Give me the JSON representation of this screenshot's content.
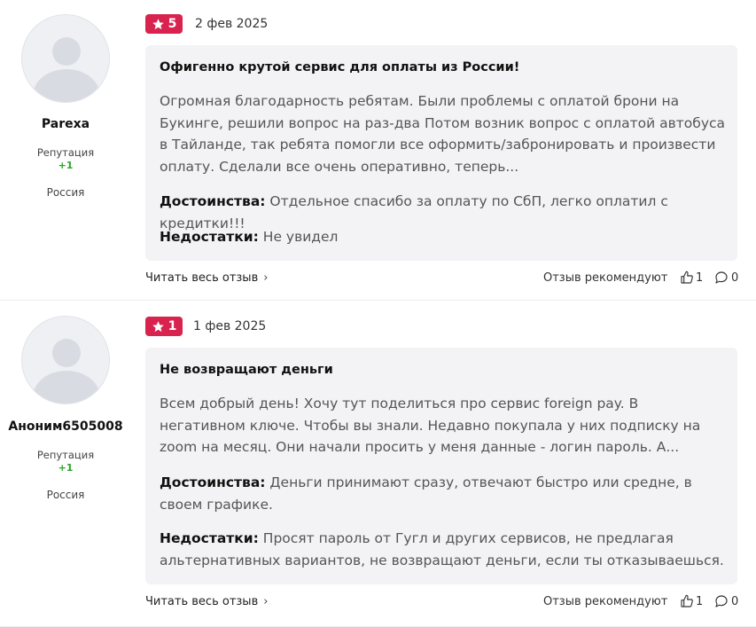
{
  "reviews": [
    {
      "username": "Parexa",
      "reputation_label": "Репутация",
      "reputation_value": "+1",
      "country": "Россия",
      "rating": "5",
      "date": "2 фев 2025",
      "title": "Офигенно крутой сервис для оплаты из России!",
      "text": "Огромная благодарность ребятам. Были проблемы с оплатой брони на Букинге, решили вопрос на раз-два Потом возник вопрос с оплатой автобуса в Тайланде, так ребята помогли все оформить/забронировать и произвести оплату. Сделали все очень оперативно, теперь...",
      "pros_label": "Достоинства:",
      "pros": "Отдельное спасибо за оплату по СбП, легко оплатил с кредитки!!!",
      "cons_label": "Недостатки:",
      "cons": "Не увидел",
      "read_more": "Читать весь отзыв",
      "recommend_label": "Отзыв рекомендуют",
      "likes": "1",
      "comments": "0"
    },
    {
      "username": "Аноним6505008",
      "reputation_label": "Репутация",
      "reputation_value": "+1",
      "country": "Россия",
      "rating": "1",
      "date": "1 фев 2025",
      "title": "Не возвращают деньги",
      "text": "Всем добрый день! Хочу тут поделиться про сервис foreign pay. В негативном ключе. Чтобы вы знали. Недавно покупала у них подписку на zoom на месяц. Они начали просить у меня данные - логин пароль. А...",
      "pros_label": "Достоинства:",
      "pros": "Деньги принимают сразу, отвечают быстро или средне, в своем графике.",
      "cons_label": "Недостатки:",
      "cons": "Просят пароль от Гугл и других сервисов, не предлагая альтернативных вариантов, не возвращают деньги, если ты отказываешься.",
      "read_more": "Читать весь отзыв",
      "recommend_label": "Отзыв рекомендуют",
      "likes": "1",
      "comments": "0"
    }
  ],
  "colors": {
    "rating_badge": "#d8234f",
    "reputation": "#2aa528",
    "card_bg": "#f3f3f5"
  },
  "icons": [
    "star-icon",
    "chevron-right-icon",
    "thumbs-up-icon",
    "comment-icon"
  ]
}
